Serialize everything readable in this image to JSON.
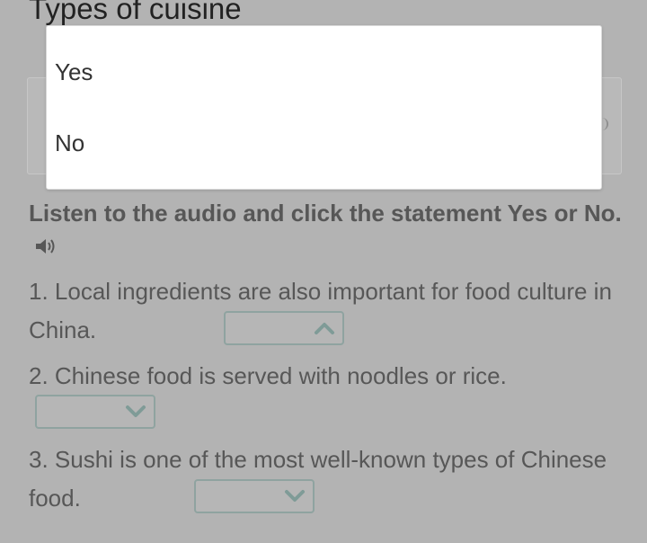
{
  "page": {
    "title": "Types of cuisine"
  },
  "dropdown": {
    "options": [
      "Yes",
      "No"
    ]
  },
  "instruction": {
    "text": "Listen to the audio and click the statement Yes or No."
  },
  "questions": [
    {
      "text": "1. Local ingredients are also important for food culture in China.",
      "selected": "",
      "state": "open"
    },
    {
      "text": "2. Chinese food is served with noodles or rice.",
      "selected": "",
      "state": "closed"
    },
    {
      "text": "3. Sushi is one of the most well-known types of Chinese food.",
      "selected": "",
      "state": "closed"
    }
  ],
  "colors": {
    "background": "#b3b3b3",
    "text": "#575757",
    "select_border": "#8fa3a0",
    "chevron": "#7f9b97"
  },
  "icons": {
    "audio": "speaker-icon",
    "open_select": "chevron-up-icon",
    "closed_select": "chevron-down-icon"
  }
}
